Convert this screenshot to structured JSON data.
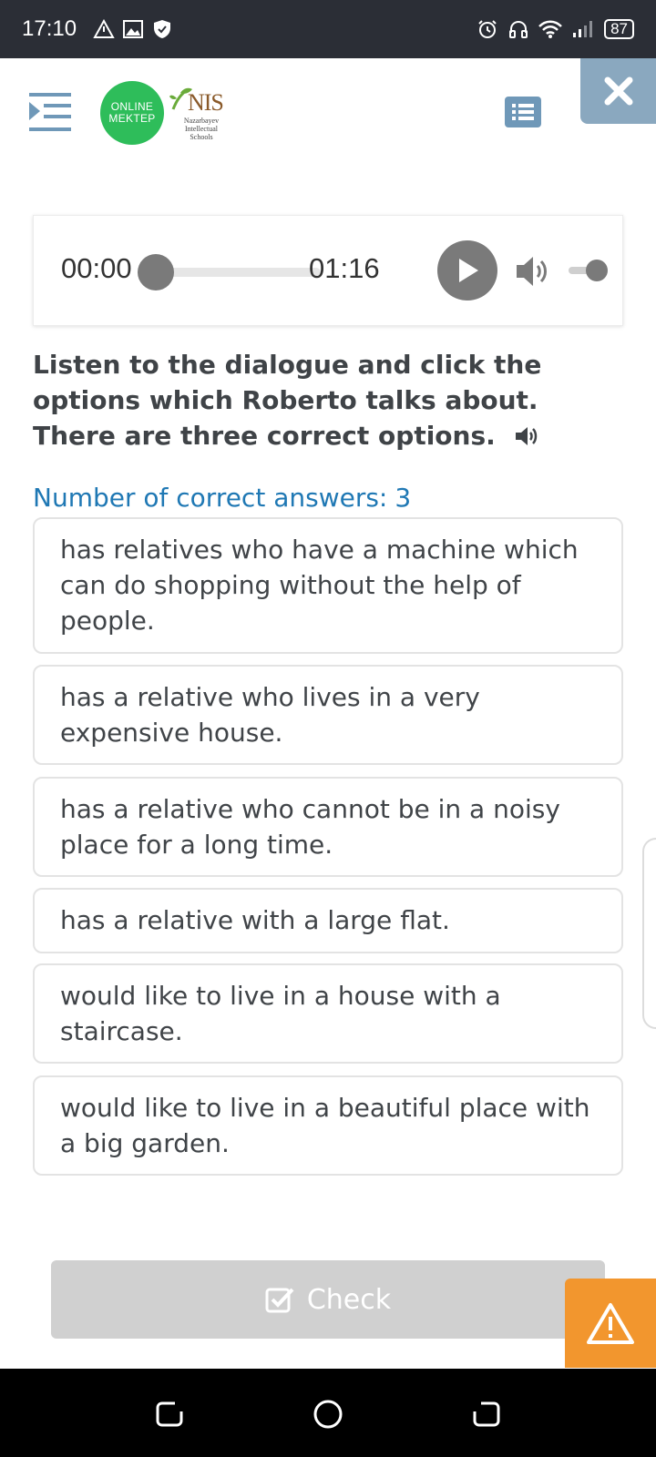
{
  "status_bar": {
    "time": "17:10",
    "battery": "87",
    "left_icons": [
      "delta-icon",
      "image-icon",
      "shield-icon"
    ],
    "right_icons": [
      "alarm-icon",
      "headset-icon",
      "wifi-icon",
      "signal-icon",
      "battery-icon"
    ]
  },
  "header": {
    "logo_online_line1": "ONLINE",
    "logo_online_line2": "MEKTEP",
    "logo_nis": "NIS",
    "logo_nis_sub": "Nazarbayev Intellectual Schools",
    "icons": [
      "menu-icon",
      "list-icon",
      "close-icon"
    ]
  },
  "audio": {
    "current_time": "00:00",
    "total_time": "01:16",
    "progress": 0,
    "volume": 0.9
  },
  "question": {
    "text": "Listen to the dialogue and click the options which Roberto talks about. There are three correct options.",
    "counter_label": "Number of correct answers:",
    "counter_value": "3"
  },
  "options": [
    "has relatives who have a machine which can do shopping without the help of people.",
    "has a relative who lives in a very expensive house.",
    "has a relative who cannot be in a noisy place for a long time.",
    "has a relative with a large flat.",
    "would like to live in a house with a staircase.",
    "would like to live in a beautiful place with a big garden."
  ],
  "actions": {
    "check_label": "Check"
  },
  "colors": {
    "status_bg": "#2b2e36",
    "accent_blue": "#1f78b4",
    "online_green": "#2ebd5a",
    "close_bg": "#8aa8bf",
    "check_disabled": "#d0d0d0",
    "report_orange": "#f2962e"
  }
}
